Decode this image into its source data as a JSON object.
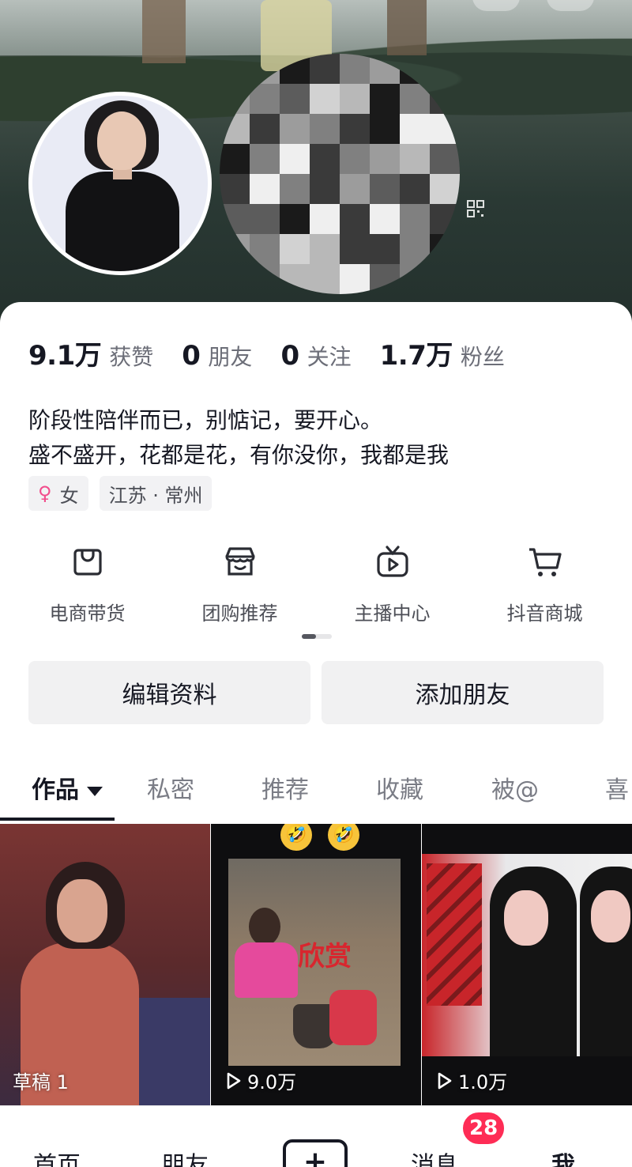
{
  "profile": {
    "stats": [
      {
        "value": "9.1万",
        "label": "获赞"
      },
      {
        "value": "0",
        "label": "朋友"
      },
      {
        "value": "0",
        "label": "关注"
      },
      {
        "value": "1.7万",
        "label": "粉丝"
      }
    ],
    "bio_line1": "阶段性陪伴而已，别惦记，要开心。",
    "bio_line2": "盛不盛开，花都是花，有你没你，我都是我",
    "gender_symbol": "♀",
    "gender_label": "女",
    "location_label": "江苏 · 常州"
  },
  "tools": [
    {
      "label": "电商带货",
      "icon": "shopping-bag-icon"
    },
    {
      "label": "团购推荐",
      "icon": "store-icon"
    },
    {
      "label": "主播中心",
      "icon": "tv-play-icon"
    },
    {
      "label": "抖音商城",
      "icon": "cart-icon"
    }
  ],
  "actions": {
    "edit_profile": "编辑资料",
    "add_friend": "添加朋友"
  },
  "tabs": [
    {
      "label": "作品",
      "active": true
    },
    {
      "label": "私密"
    },
    {
      "label": "推荐"
    },
    {
      "label": "收藏"
    },
    {
      "label": "被@"
    },
    {
      "label": "喜"
    }
  ],
  "videos": [
    {
      "label": "草稿 1",
      "type": "draft"
    },
    {
      "label": "9.0万",
      "type": "plays",
      "overlay_text": "欣赏",
      "emoji": "🤣"
    },
    {
      "label": "1.0万",
      "type": "plays"
    }
  ],
  "bottom_nav": {
    "home": "首页",
    "friends": "朋友",
    "plus": "+",
    "messages": "消息",
    "messages_badge": "28",
    "me": "我"
  },
  "colors": {
    "accent_badge": "#fe2c55",
    "female_icon": "#f24d8c",
    "text_primary": "#161823",
    "text_secondary": "#6c6e78"
  }
}
